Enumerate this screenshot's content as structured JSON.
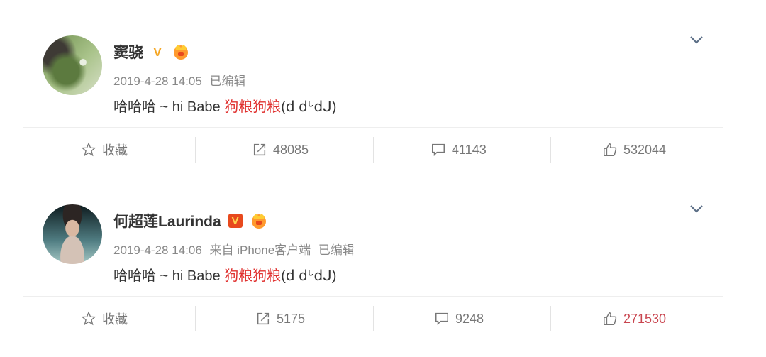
{
  "posts": [
    {
      "author": "窦骁",
      "timestamp": "2019-4-28 14:05",
      "source": "",
      "edited": "已编辑",
      "content_prefix": "哈哈哈 ~ hi Babe ",
      "content_highlight": "狗粮狗粮",
      "content_suffix": "(ⅾ ⅾᒡⅾᒍ)",
      "verified_badge": "V",
      "actions": {
        "favorite_label": "收藏",
        "repost_count": "48085",
        "comment_count": "41143",
        "like_count": "532044"
      }
    },
    {
      "author": "何超莲Laurinda",
      "timestamp": "2019-4-28 14:06",
      "source": "来自 iPhone客户端",
      "edited": "已编辑",
      "content_prefix": "哈哈哈 ~ hi Babe ",
      "content_highlight": "狗粮狗粮",
      "content_suffix": "(ⅾ ⅾᒡⅾᒍ)",
      "verified_badge": "V",
      "actions": {
        "favorite_label": "收藏",
        "repost_count": "5175",
        "comment_count": "9248",
        "like_count": "271530"
      }
    }
  ],
  "colors": {
    "highlight": "#e0312f",
    "liked": "#c9454f",
    "verified_yellow": "#f5a623",
    "verified_red": "#e8491d"
  },
  "icons": [
    "star-icon",
    "repost-icon",
    "comment-icon",
    "like-icon",
    "chevron-down-icon",
    "vip-icon"
  ]
}
